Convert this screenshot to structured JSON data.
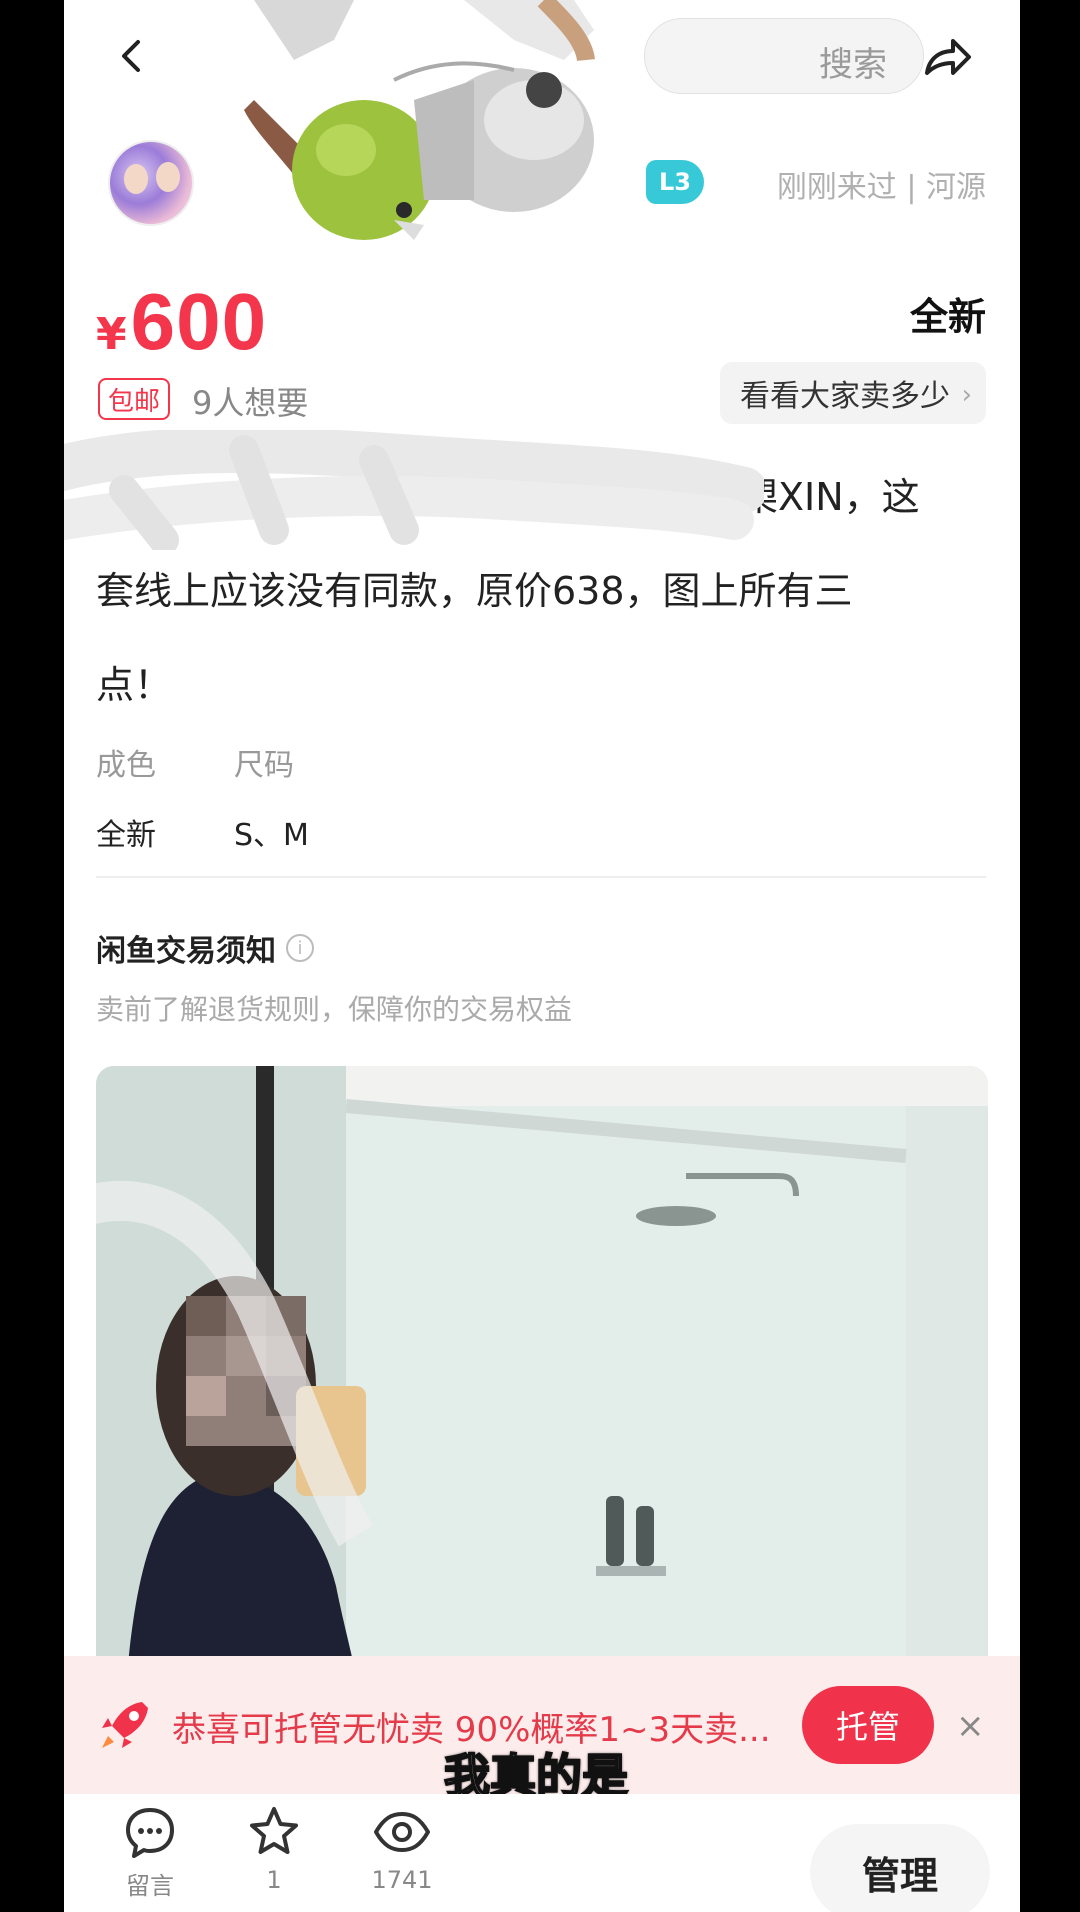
{
  "header": {
    "search_label": "搜索"
  },
  "seller": {
    "level": "L3",
    "meta": "刚刚来过 | 河源"
  },
  "price": {
    "currency": "¥",
    "amount": "600"
  },
  "condition_badge": "全新",
  "tags": {
    "shipping": "包邮",
    "wants": "9人想要"
  },
  "price_reference_button": "看看大家卖多少",
  "description": {
    "line1": "的品牌槊XIN，这",
    "line2": "套线上应该没有同款，原价638，图上所有三",
    "line3": "点！"
  },
  "specs": [
    {
      "label": "成色",
      "value": "全新"
    },
    {
      "label": "尺码",
      "value": "S、M"
    }
  ],
  "notice": {
    "title": "闲鱼交易须知",
    "subtitle": "卖前了解退货规则，保障你的交易权益"
  },
  "promo": {
    "text": "恭喜可托管无忧卖 90%概率1~3天卖...",
    "button": "托管",
    "close": "×"
  },
  "video_subtitle": "我真的是",
  "bottom_bar": {
    "comment_label": "留言",
    "favorite_count": "1",
    "view_count": "1741",
    "manage_button": "管理"
  },
  "colors": {
    "price_red": "#f4364c",
    "badge_cyan": "#38c9d8",
    "highlight_yellow": "#ffe400",
    "promo_bg": "#fdecec"
  }
}
